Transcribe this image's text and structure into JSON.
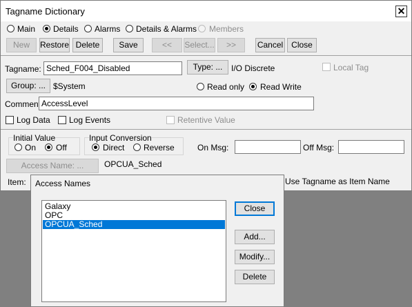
{
  "window": {
    "title": "Tagname Dictionary",
    "close_glyph": "✕"
  },
  "mode_tabs": [
    {
      "label": "Main",
      "selected": false,
      "enabled": true
    },
    {
      "label": "Details",
      "selected": true,
      "enabled": true
    },
    {
      "label": "Alarms",
      "selected": false,
      "enabled": true
    },
    {
      "label": "Details & Alarms",
      "selected": false,
      "enabled": true
    },
    {
      "label": "Members",
      "selected": false,
      "enabled": false
    }
  ],
  "toolbar": {
    "new": "New",
    "restore": "Restore",
    "delete": "Delete",
    "save": "Save",
    "prev": "<<",
    "select": "Select...",
    "next": ">>",
    "cancel": "Cancel",
    "close": "Close"
  },
  "tag": {
    "tagname_label": "Tagname:",
    "tagname_value": "Sched_F004_Disabled",
    "type_button": "Type: ...",
    "type_value": "I/O Discrete",
    "local_tag": "Local Tag",
    "group_button": "Group: ...",
    "group_value": "$System",
    "read_only": "Read only",
    "read_write": "Read Write",
    "comment_label": "Comment:",
    "comment_value": "AccessLevel",
    "log_data": "Log Data",
    "log_events": "Log Events",
    "retentive_value": "Retentive Value"
  },
  "details": {
    "initial_value_label": "Initial Value",
    "on": "On",
    "off": "Off",
    "input_conversion_label": "Input Conversion",
    "direct": "Direct",
    "reverse": "Reverse",
    "on_msg_label": "On Msg:",
    "on_msg_value": "",
    "off_msg_label": "Off Msg:",
    "off_msg_value": "",
    "access_name_button": "Access Name: ...",
    "access_name_value": "OPCUA_Sched",
    "item_label": "Item:",
    "use_tagname": "Use Tagname as Item Name"
  },
  "access_names_dialog": {
    "title": "Access Names",
    "items": [
      "Galaxy",
      "OPC",
      "OPCUA_Sched"
    ],
    "selected_index": 2,
    "close": "Close",
    "add": "Add...",
    "modify": "Modify...",
    "delete": "Delete"
  },
  "colors": {
    "selection": "#0078d7",
    "dialog_background": "#f0f0f0",
    "desktop_background": "#808080"
  }
}
